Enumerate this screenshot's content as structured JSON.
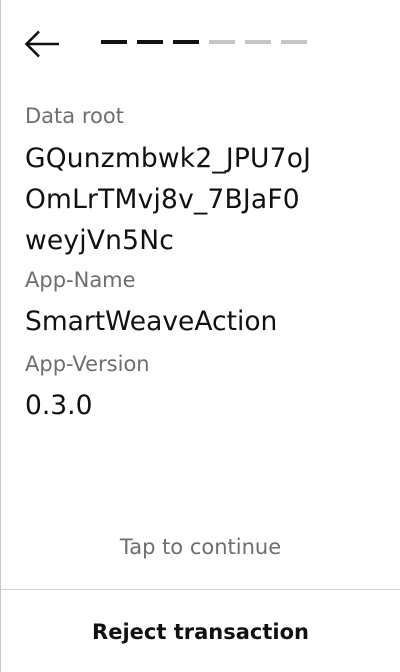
{
  "header": {
    "back_icon": "arrow-left-icon",
    "steps_total": 6,
    "steps_completed": 3,
    "colors": {
      "active": "#111111",
      "inactive": "#c6c6c6"
    }
  },
  "fields": {
    "data_root": {
      "label": "Data root",
      "value_lines": [
        "GQunzmbwk2_JPU7oJ",
        "OmLrTMvj8v_7BJaF0",
        "weyjVn5Nc"
      ]
    },
    "app_name": {
      "label": "App-Name",
      "value": "SmartWeaveAction"
    },
    "app_version": {
      "label": "App-Version",
      "value": "0.3.0"
    }
  },
  "footer": {
    "hint": "Tap to continue",
    "reject_label": "Reject transaction"
  }
}
